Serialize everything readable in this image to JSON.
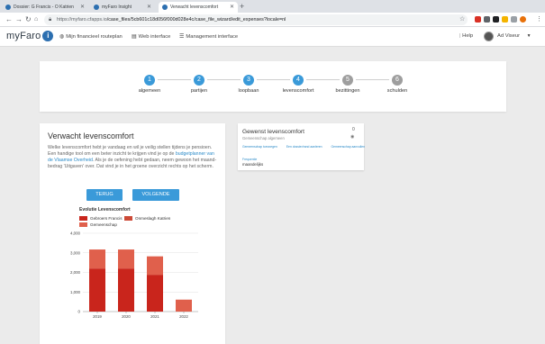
{
  "browser": {
    "tabs": [
      {
        "title": "Dossier: G Francis - O Katrien",
        "active": false,
        "favicon_color": "#2c6fb0"
      },
      {
        "title": "myFaro Insight",
        "active": false,
        "favicon_color": "#2c6fb0"
      },
      {
        "title": "Verwacht levenscomfort",
        "active": true,
        "favicon_color": "#2c6fb0"
      }
    ],
    "new_tab_glyph": "+",
    "url_host": "https://myfaro.cfapps.io",
    "url_path": "/case_files/5cb601c18d056f000d028e4c/case_file_wizard/edit_expenses?locale=nl",
    "extension_colors": [
      "#d93025",
      "#5f6368",
      "#202124",
      "#f4b400",
      "#9aa0a6",
      "#9aa0a6",
      "#e8710a",
      "#5f6368"
    ]
  },
  "app": {
    "logo_text": "myFaro",
    "logo_glyph": "i",
    "nav": [
      {
        "icon": "globe-icon",
        "glyph": "◍",
        "label": "Mijn financieel routeplan"
      },
      {
        "icon": "bank-icon",
        "glyph": "▤",
        "label": "Web interface"
      },
      {
        "icon": "menu-icon",
        "glyph": "☰",
        "label": "Management interface"
      }
    ],
    "help_label": "Help",
    "user_name": "Ad Viseur"
  },
  "wizard": {
    "steps": [
      {
        "num": "1",
        "label": "algemeen",
        "done": true
      },
      {
        "num": "2",
        "label": "partijen",
        "done": true
      },
      {
        "num": "3",
        "label": "loopbaan",
        "done": true
      },
      {
        "num": "4",
        "label": "levenscomfort",
        "done": true
      },
      {
        "num": "5",
        "label": "bezittingen",
        "done": false
      },
      {
        "num": "6",
        "label": "schulden",
        "done": false
      }
    ],
    "active_color": "#3a9ad9",
    "inactive_color": "#9e9e9e"
  },
  "main_card": {
    "title": "Verwacht levenscomfort",
    "desc_1": "Welke levenscomfort hebt je vandaag en wil je veilig stellen tijdens je pensioen. Een handige tool om een beter inzicht te krijgen vind je op de ",
    "desc_link": "budgetplanner van de Vlaamse Overheid",
    "desc_2": ". Als je de oefening hebt gedaan, neem gewoon het maand-bedrag 'Uitgaven' over. Dat vind je in het groene overzicht rechts op het scherm.",
    "back_label": "TERUG",
    "next_label": "VOLGENDE"
  },
  "chart_data": {
    "type": "bar",
    "stacked": true,
    "title": "Evolutie Levenscomfort",
    "categories": [
      "2019",
      "2020",
      "2021",
      "2022"
    ],
    "ylim": [
      0,
      4000
    ],
    "yticks": [
      "0",
      "1,000",
      "2,000",
      "3,000",
      "4,000"
    ],
    "ytick_values": [
      0,
      1000,
      2000,
      3000,
      4000
    ],
    "series": [
      {
        "name": "Gebroers Francis",
        "color": "#c9251c",
        "values": [
          2200,
          2200,
          1880,
          0
        ]
      },
      {
        "name": "Onmeslagh Katrien",
        "color": "#cc4a37",
        "values": [
          0,
          0,
          0,
          0
        ]
      },
      {
        "name": "Gemeenschap",
        "color": "#e0604c",
        "values": [
          970,
          970,
          940,
          610
        ]
      }
    ],
    "grid": true,
    "legend_position": "top"
  },
  "side_card": {
    "title": "Gewenst levenscomfort",
    "subtitle": "Gemeenschap algemeen",
    "count": "0",
    "tabs": [
      "Gemeenschap toevoegen",
      "Een dossier/rand aanleren",
      "Gemeenschap aanvullen"
    ],
    "freq_label": "Frequentie",
    "freq_value": "maandelijks"
  }
}
